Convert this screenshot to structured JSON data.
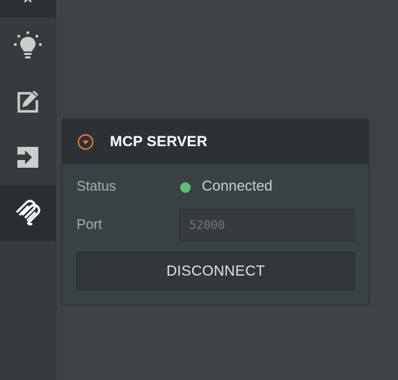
{
  "sidebar": {
    "items": [
      {
        "icon": "chevron-up-icon",
        "active": false
      },
      {
        "icon": "lightbulb-icon",
        "active": false
      },
      {
        "icon": "edit-icon",
        "active": false
      },
      {
        "icon": "sign-in-icon",
        "active": false
      },
      {
        "icon": "mcp-icon",
        "active": true
      }
    ]
  },
  "panel": {
    "title": "MCP SERVER",
    "collapse_icon": "chevron-down-circle-icon",
    "status_label": "Status",
    "status_value": "Connected",
    "status_color": "#5dbc7d",
    "port_label": "Port",
    "port_value": "",
    "port_placeholder": "52000",
    "disconnect_label": "DISCONNECT"
  },
  "colors": {
    "accent": "#e8773f",
    "background": "#3e4446",
    "sidebar": "#363b3d",
    "panel_header": "#2c3234"
  }
}
